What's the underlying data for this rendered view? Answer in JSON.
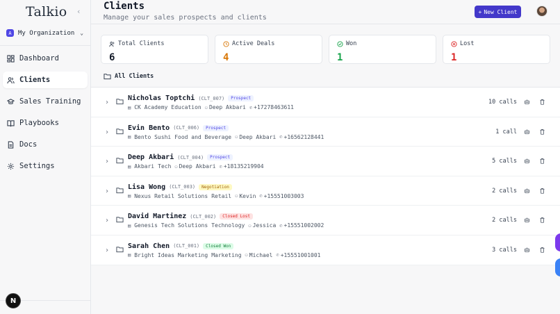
{
  "sidebar": {
    "logo": "Talkio",
    "collapse_icon": "chevron-left-icon",
    "organization": {
      "badge": "A",
      "name": "My Organization"
    },
    "items": [
      {
        "label": "Dashboard",
        "icon": "dashboard-icon",
        "active": false
      },
      {
        "label": "Clients",
        "icon": "users-icon",
        "active": true
      },
      {
        "label": "Sales Training",
        "icon": "graduation-cap-icon",
        "active": false
      },
      {
        "label": "Playbooks",
        "icon": "book-icon",
        "active": false
      },
      {
        "label": "Docs",
        "icon": "document-icon",
        "active": false
      },
      {
        "label": "Settings",
        "icon": "gear-icon",
        "active": false
      }
    ],
    "bottom_badge": "N"
  },
  "header": {
    "title": "Clients",
    "subtitle": "Manage your sales prospects and clients",
    "new_button": "New Client",
    "new_button_icon": "+"
  },
  "stats": [
    {
      "label": "Total Clients",
      "value": "6",
      "color": "#111827",
      "icon": "users-icon"
    },
    {
      "label": "Active Deals",
      "value": "4",
      "color": "#d97706",
      "icon": "clock-icon"
    },
    {
      "label": "Won",
      "value": "1",
      "color": "#16a34a",
      "icon": "check-circle-icon"
    },
    {
      "label": "Lost",
      "value": "1",
      "color": "#dc2626",
      "icon": "x-circle-icon"
    }
  ],
  "section_title": "All Clients",
  "clients": [
    {
      "name": "Nicholas Toptchi",
      "code": "(CLT_007)",
      "status": "Prospect",
      "status_class": "st-prospect",
      "company": "CK Academy",
      "industry": "Education",
      "owner": "Deep Akbari",
      "phone": "+17278463611",
      "calls": "10 calls"
    },
    {
      "name": "Evin Bento",
      "code": "(CLT_006)",
      "status": "Prospect",
      "status_class": "st-prospect",
      "company": "Bento Sushi",
      "industry": "Food and Beverage",
      "owner": "Deep Akbari",
      "phone": "+16562128441",
      "calls": "1 call"
    },
    {
      "name": "Deep Akbari",
      "code": "(CLT_004)",
      "status": "Prospect",
      "status_class": "st-prospect",
      "company": "Akbari",
      "industry": "Tech",
      "owner": "Deep Akbari",
      "phone": "+18135219904",
      "calls": "5 calls"
    },
    {
      "name": "Lisa Wong",
      "code": "(CLT_003)",
      "status": "Negotiation",
      "status_class": "st-negotiation",
      "company": "Nexus Retail Solutions",
      "industry": "Retail",
      "owner": "Kevin",
      "phone": "+15551003003",
      "calls": "2 calls"
    },
    {
      "name": "David Martinez",
      "code": "(CLT_002)",
      "status": "Closed Lost",
      "status_class": "st-lost",
      "company": "Genesis Tech Solutions",
      "industry": "Technology",
      "owner": "Jessica",
      "phone": "+15551002002",
      "calls": "2 calls"
    },
    {
      "name": "Sarah Chen",
      "code": "(CLT_001)",
      "status": "Closed Won",
      "status_class": "st-won",
      "company": "Bright Ideas Marketing",
      "industry": "Marketing",
      "owner": "Michael",
      "phone": "+15551001001",
      "calls": "3 calls"
    }
  ],
  "colors": {
    "accent": "#4338ca",
    "fab_top": "#7c3aed",
    "fab_bottom": "#3b82f6"
  }
}
